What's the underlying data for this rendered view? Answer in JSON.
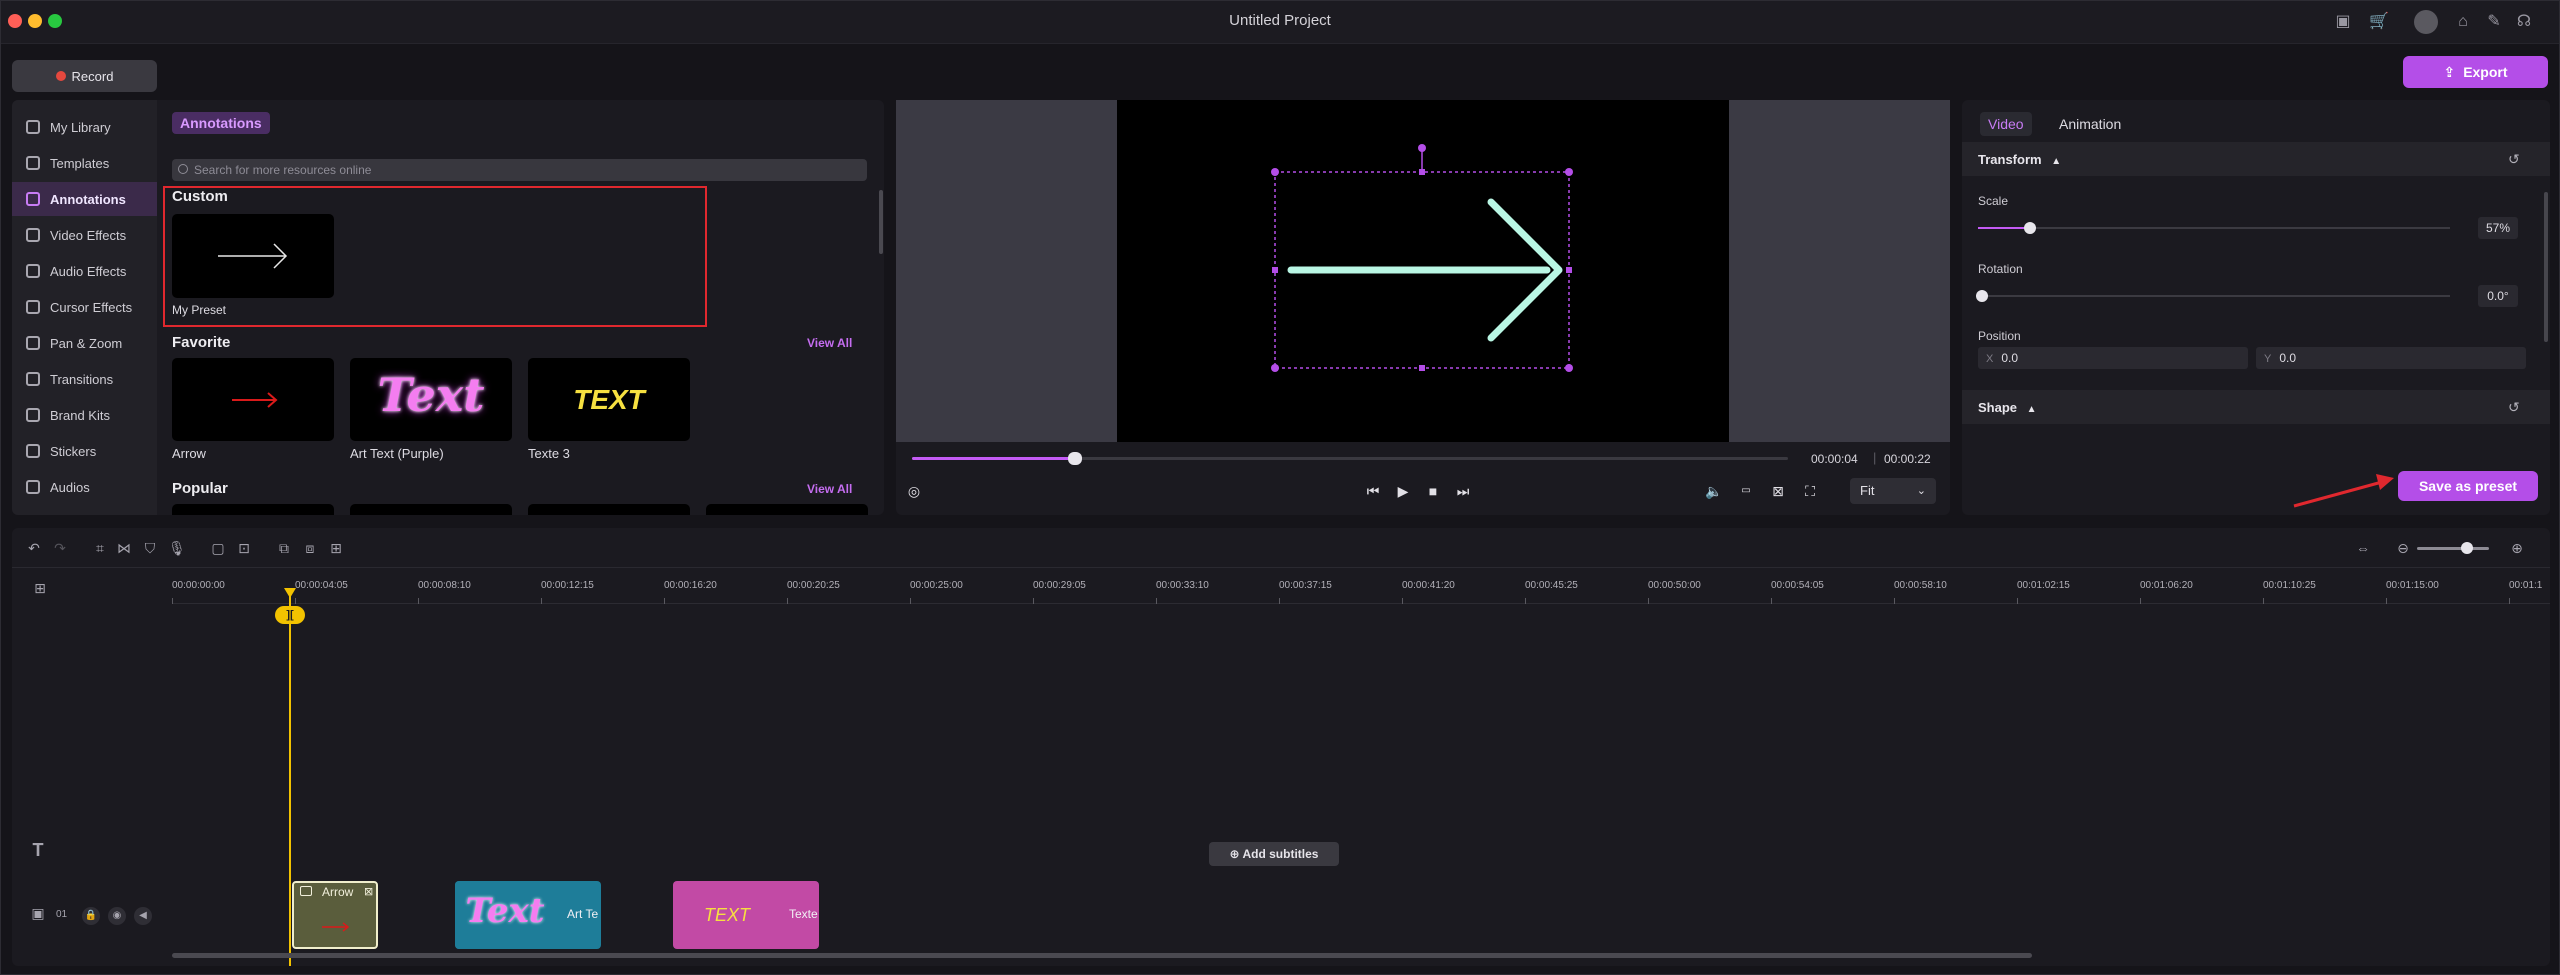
{
  "window": {
    "title": "Untitled Project"
  },
  "toolbar": {
    "record_label": "Record",
    "export_label": "Export"
  },
  "sidebar": {
    "items": [
      {
        "label": "My Library",
        "icon": "library-icon"
      },
      {
        "label": "Templates",
        "icon": "templates-icon"
      },
      {
        "label": "Annotations",
        "icon": "annotations-icon",
        "active": true
      },
      {
        "label": "Video Effects",
        "icon": "video-effects-icon"
      },
      {
        "label": "Audio Effects",
        "icon": "audio-effects-icon"
      },
      {
        "label": "Cursor Effects",
        "icon": "cursor-effects-icon"
      },
      {
        "label": "Pan & Zoom",
        "icon": "pan-zoom-icon"
      },
      {
        "label": "Transitions",
        "icon": "transitions-icon"
      },
      {
        "label": "Brand Kits",
        "icon": "brand-kits-icon"
      },
      {
        "label": "Stickers",
        "icon": "stickers-icon"
      },
      {
        "label": "Audios",
        "icon": "audios-icon"
      }
    ]
  },
  "library": {
    "tab_label": "Annotations",
    "search_placeholder": "Search for more resources online",
    "custom": {
      "title": "Custom",
      "items": [
        {
          "label": "My Preset"
        }
      ]
    },
    "favorite": {
      "title": "Favorite",
      "view_all": "View All",
      "items": [
        {
          "label": "Arrow"
        },
        {
          "label": "Art Text (Purple)",
          "thumb_text": "Text"
        },
        {
          "label": "Texte 3",
          "thumb_text": "TEXT"
        }
      ]
    },
    "popular": {
      "title": "Popular",
      "view_all": "View All"
    }
  },
  "preview": {
    "time_current": "00:00:04",
    "time_separator": "|",
    "time_total": "00:00:22",
    "fit_label": "Fit",
    "progress": 0.18
  },
  "properties": {
    "tabs": {
      "video": "Video",
      "animation": "Animation"
    },
    "transform_title": "Transform",
    "scale_label": "Scale",
    "scale_value": "57%",
    "scale_fraction": 0.07,
    "rotation_label": "Rotation",
    "rotation_value": "0.0°",
    "position_label": "Position",
    "pos_x_axis": "X",
    "pos_x": "0.0",
    "pos_y_axis": "Y",
    "pos_y": "0.0",
    "shape_title": "Shape",
    "save_preset_label": "Save as preset"
  },
  "timeline": {
    "ticks": [
      "00:00:00:00",
      "00:00:04:05",
      "00:00:08:10",
      "00:00:12:15",
      "00:00:16:20",
      "00:00:20:25",
      "00:00:25:00",
      "00:00:29:05",
      "00:00:33:10",
      "00:00:37:15",
      "00:00:41:20",
      "00:00:45:25",
      "00:00:50:00",
      "00:00:54:05",
      "00:00:58:10",
      "00:01:02:15",
      "00:01:06:20",
      "00:01:10:25",
      "00:01:15:00",
      "00:01:1"
    ],
    "playhead_label": "][",
    "add_subtitles": "Add subtitles",
    "track_number": "01",
    "clips": {
      "arrow": "Arrow",
      "art_text": "Art Te",
      "art_text_thumb": "Text",
      "texte": "Texte",
      "texte_thumb": "TEXT"
    }
  },
  "colors": {
    "accent": "#b44ee8",
    "playhead": "#f2c200",
    "highlight_box": "#e0282e"
  }
}
